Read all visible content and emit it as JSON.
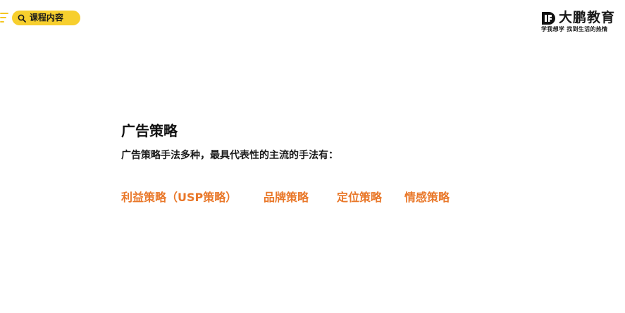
{
  "header": {
    "search_label": "课程内容",
    "brand_name": "大鹏教育",
    "brand_slogan": "学我想学 找到生活的热情",
    "accent_color": "#f7cf2e"
  },
  "icons": {
    "search": "search-icon",
    "logo": "dp-logo-icon",
    "menu": "menu-lines-icon"
  },
  "slide": {
    "title": "广告策略",
    "subtitle": "广告策略手法多种，最具代表性的主流的手法有：",
    "strategies": [
      "利益策略（USP策略）",
      "品牌策略",
      "定位策略",
      "情感策略"
    ],
    "strategy_color": "#e9782a"
  }
}
